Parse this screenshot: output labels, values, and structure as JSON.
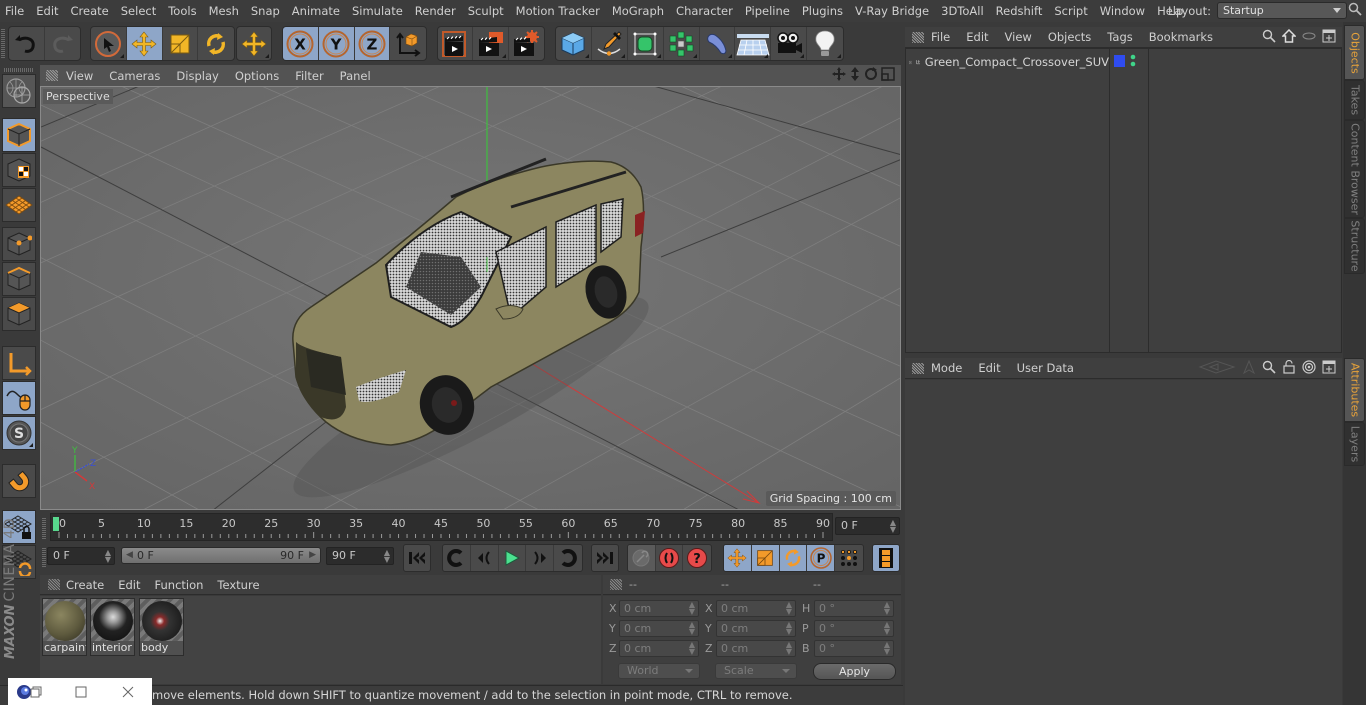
{
  "app": {
    "name": "Cinema 4D",
    "brand_top": "MAXON",
    "brand_bottom": "CINEMA 4D"
  },
  "menubar": {
    "items": [
      "File",
      "Edit",
      "Create",
      "Select",
      "Tools",
      "Mesh",
      "Snap",
      "Animate",
      "Simulate",
      "Render",
      "Sculpt",
      "Motion Tracker",
      "MoGraph",
      "Character",
      "Pipeline",
      "Plugins",
      "V-Ray Bridge",
      "3DToAll",
      "Redshift",
      "Script",
      "Window",
      "Help"
    ],
    "layout_label": "Layout:",
    "layout_value": "Startup"
  },
  "toolbar": {
    "groups": [
      {
        "buttons": [
          {
            "icon": "undo-icon",
            "active": false
          },
          {
            "icon": "redo-icon",
            "active": false
          }
        ]
      },
      {
        "buttons": [
          {
            "icon": "select-arrow-icon",
            "active": false
          },
          {
            "icon": "move-icon",
            "active": true
          },
          {
            "icon": "scale-icon",
            "active": false
          },
          {
            "icon": "rotate-icon",
            "active": false
          }
        ]
      },
      {
        "buttons": [
          {
            "icon": "move-tool-icon",
            "active": false
          }
        ]
      },
      {
        "buttons": [
          {
            "icon": "x-axis-icon",
            "label": "X",
            "active": true
          },
          {
            "icon": "y-axis-icon",
            "label": "Y",
            "active": true
          },
          {
            "icon": "z-axis-icon",
            "label": "Z",
            "active": true
          },
          {
            "icon": "coordinate-system-icon",
            "active": false
          }
        ]
      },
      {
        "buttons": [
          {
            "icon": "render-view-icon",
            "active": false
          },
          {
            "icon": "render-picture-viewer-icon",
            "active": false
          },
          {
            "icon": "render-settings-icon",
            "active": false
          }
        ]
      },
      {
        "buttons": [
          {
            "icon": "cube-icon",
            "active": false
          },
          {
            "icon": "pen-spline-icon",
            "active": false
          },
          {
            "icon": "subdivision-icon",
            "active": false
          },
          {
            "icon": "cloner-icon",
            "active": false
          },
          {
            "icon": "deformer-icon",
            "active": false
          },
          {
            "icon": "floor-icon",
            "active": false
          },
          {
            "icon": "camera-icon",
            "active": false
          },
          {
            "icon": "light-icon",
            "active": false
          }
        ]
      }
    ]
  },
  "left_palette": [
    {
      "icon": "make-editable-icon",
      "active": false
    },
    {
      "icon": "model-mode-icon",
      "active": true
    },
    {
      "icon": "texture-mode-icon",
      "active": false
    },
    {
      "icon": "workplane-mode-icon",
      "active": false
    },
    {
      "icon": "points-mode-icon",
      "active": false
    },
    {
      "icon": "edges-mode-icon",
      "active": false
    },
    {
      "icon": "polygons-mode-icon",
      "active": false
    },
    {
      "icon": "axis-mode-icon",
      "active": false
    },
    {
      "icon": "tweak-mode-icon",
      "active": true
    },
    {
      "icon": "solo-mode-icon",
      "active": true
    },
    {
      "icon": "snap-magnet-icon",
      "active": false
    },
    {
      "icon": "workplane-lock-icon",
      "active": true
    },
    {
      "icon": "workplane-align-icon",
      "active": false
    }
  ],
  "viewport": {
    "menu": [
      "View",
      "Cameras",
      "Display",
      "Options",
      "Filter",
      "Panel"
    ],
    "camera_label": "Perspective",
    "grid_spacing": "Grid Spacing : 100 cm",
    "axis_labels": {
      "x": "X",
      "y": "Y",
      "z": "Z"
    },
    "colors": {
      "x_axis": "#d23a3a",
      "y_axis": "#3fbf3f",
      "z_axis": "#3a4fd2",
      "car_body": "#8c8660"
    }
  },
  "timeline": {
    "tick_labels": [
      "0",
      "5",
      "10",
      "15",
      "20",
      "25",
      "30",
      "35",
      "40",
      "45",
      "50",
      "55",
      "60",
      "65",
      "70",
      "75",
      "80",
      "85",
      "90"
    ],
    "current_frame": "0 F",
    "start_frame": "0 F",
    "range_start": "0 F",
    "range_end": "90 F",
    "end_frame": "90 F"
  },
  "transport": {
    "playback": [
      "goto-start-icon",
      "prev-key-icon",
      "prev-frame-icon",
      "play-icon",
      "next-frame-icon",
      "next-key-icon",
      "goto-end-icon"
    ],
    "keys": [
      "record-disabled-icon",
      "record-keyframe-icon",
      "autokey-icon"
    ],
    "key_tracks": [
      "key-position-icon",
      "key-scale-icon",
      "key-rotation-icon",
      "key-param-icon",
      "key-pla-icon"
    ],
    "timeline_button": "timeline-icon"
  },
  "material_manager": {
    "menu": [
      "Create",
      "Edit",
      "Function",
      "Texture"
    ],
    "materials": [
      {
        "name": "carpaint"
      },
      {
        "name": "interior"
      },
      {
        "name": "body"
      }
    ]
  },
  "coordinates": {
    "headers": [
      "--",
      "--",
      "--"
    ],
    "rows": [
      {
        "l1": "X",
        "v1": "0 cm",
        "l2": "X",
        "v2": "0 cm",
        "l3": "H",
        "v3": "0 °"
      },
      {
        "l1": "Y",
        "v1": "0 cm",
        "l2": "Y",
        "v2": "0 cm",
        "l3": "P",
        "v3": "0 °"
      },
      {
        "l1": "Z",
        "v1": "0 cm",
        "l2": "Z",
        "v2": "0 cm",
        "l3": "B",
        "v3": "0 °"
      }
    ],
    "space_value": "World",
    "mode_value": "Scale",
    "apply_label": "Apply"
  },
  "status": {
    "text": "move elements. Hold down SHIFT to quantize movement / add to the selection in point mode, CTRL to remove."
  },
  "objects_panel": {
    "menu": [
      "File",
      "Edit",
      "View",
      "Objects",
      "Tags",
      "Bookmarks"
    ],
    "objects": [
      {
        "name": "Green_Compact_Crossover_SUV",
        "layer_color": "#2f4cf0"
      }
    ]
  },
  "attributes_panel": {
    "menu": [
      "Mode",
      "Edit",
      "User Data"
    ]
  },
  "side_tabs": {
    "top": [
      {
        "label": "Objects",
        "active": true
      },
      {
        "label": "Takes",
        "active": false
      },
      {
        "label": "Content Browser",
        "active": false
      },
      {
        "label": "Structure",
        "active": false
      }
    ],
    "bottom": [
      {
        "label": "Attributes",
        "active": true
      },
      {
        "label": "Layers",
        "active": false
      }
    ]
  }
}
